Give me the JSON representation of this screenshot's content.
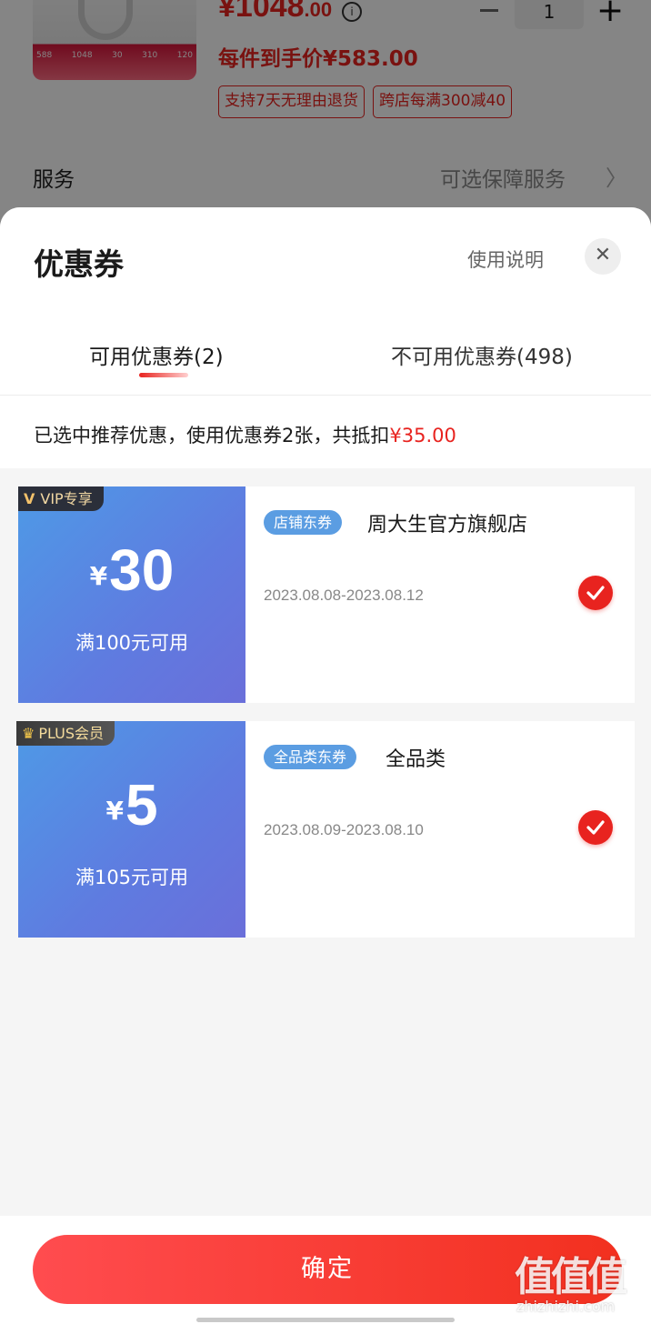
{
  "product": {
    "price_int": "¥1048",
    "price_dec": ".00",
    "unit_price": "每件到手价¥583.00",
    "quantity": "1",
    "tags": [
      "支持7天无理由退货",
      "跨店每满300减40"
    ],
    "thumb_values": [
      "588",
      "1048",
      "30",
      "310",
      "120"
    ],
    "service_label": "服务",
    "service_value": "可选保障服务"
  },
  "sheet": {
    "title": "优惠券",
    "help_label": "使用说明",
    "close_label": "✕",
    "tabs": [
      {
        "label": "可用优惠券(2)",
        "active": true
      },
      {
        "label": "不可用优惠券(498)",
        "active": false
      }
    ],
    "summary_prefix": "已选中推荐优惠，使用优惠券2张，共抵扣",
    "summary_amount": "¥35.00",
    "coupons": [
      {
        "badge": "VIP专享",
        "badge_icon": "vip-v-icon",
        "currency": "¥",
        "amount": "30",
        "condition": "满100元可用",
        "type": "店铺东券",
        "scope": "周大生官方旗舰店",
        "date_range": "2023.08.08-2023.08.12",
        "selected": true
      },
      {
        "badge": "PLUS会员",
        "badge_icon": "crown-icon",
        "currency": "¥",
        "amount": "5",
        "condition": "满105元可用",
        "type": "全品类东券",
        "scope": "全品类",
        "date_range": "2023.08.09-2023.08.10",
        "selected": true
      }
    ]
  },
  "footer": {
    "confirm_label": "确定",
    "watermark": "值值值",
    "watermark_url": "zhizhizhi.com"
  },
  "colors": {
    "accent": "#e8231f",
    "coupon_blue": "#5b9de2"
  }
}
